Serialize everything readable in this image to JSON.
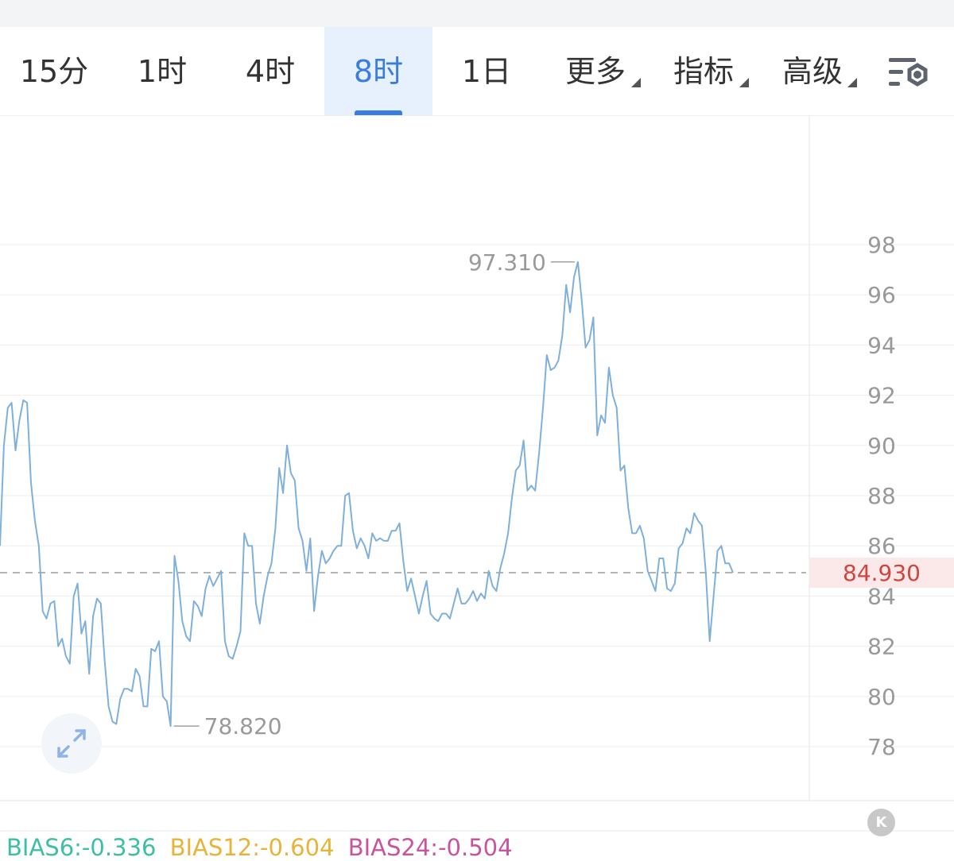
{
  "timeframe_tabs": [
    {
      "label": "15分",
      "active": false
    },
    {
      "label": "1时",
      "active": false
    },
    {
      "label": "4时",
      "active": false
    },
    {
      "label": "8时",
      "active": true
    },
    {
      "label": "1日",
      "active": false
    }
  ],
  "menu_tabs": [
    {
      "label": "更多"
    },
    {
      "label": "指标"
    },
    {
      "label": "高级"
    }
  ],
  "icons": {
    "settings": "chart-settings-icon",
    "expand": "expand-icon",
    "scroll_latest": "scroll-to-latest-icon"
  },
  "scroll_latest_label": "K",
  "colors": {
    "accent": "#3a7ce0",
    "line": "#7fb0dc",
    "current_price": "#d0453f",
    "bias6": "#3dbfa5",
    "bias12": "#e7b439",
    "bias24": "#c9549d"
  },
  "chart_data": {
    "type": "line",
    "y_axis_ticks": [
      "98",
      "96",
      "94",
      "92",
      "90",
      "88",
      "86",
      "84",
      "82",
      "80",
      "78"
    ],
    "ylim": [
      76,
      102
    ],
    "current_price": "84.930",
    "max_label": "97.310",
    "min_label": "78.820",
    "values": [
      86.0,
      90.0,
      91.5,
      91.7,
      89.8,
      91.0,
      91.8,
      91.7,
      88.5,
      87.0,
      86.0,
      83.4,
      83.1,
      83.7,
      83.8,
      82.0,
      82.3,
      81.6,
      81.3,
      84.0,
      84.5,
      82.5,
      83.0,
      80.9,
      83.2,
      83.9,
      83.7,
      81.4,
      79.6,
      79.0,
      78.9,
      79.9,
      80.3,
      80.3,
      80.2,
      81.1,
      80.8,
      79.6,
      79.6,
      81.9,
      81.8,
      82.2,
      80.0,
      79.8,
      78.82,
      85.6,
      84.6,
      83.0,
      82.4,
      82.2,
      83.8,
      83.6,
      83.2,
      84.3,
      84.8,
      84.4,
      84.7,
      85.0,
      82.2,
      81.6,
      81.5,
      82.0,
      82.6,
      86.5,
      86.0,
      86.0,
      83.7,
      82.9,
      84.0,
      84.8,
      85.3,
      86.7,
      89.1,
      88.1,
      90.0,
      88.9,
      88.6,
      86.7,
      86.2,
      85.0,
      86.3,
      83.4,
      84.8,
      85.8,
      85.3,
      85.5,
      85.8,
      86.0,
      86.0,
      88.0,
      88.1,
      86.6,
      85.9,
      86.3,
      86.0,
      85.5,
      86.5,
      86.2,
      86.3,
      86.2,
      86.2,
      86.6,
      86.6,
      86.9,
      85.4,
      84.2,
      84.7,
      84.0,
      83.3,
      84.0,
      84.6,
      83.3,
      83.1,
      83.0,
      83.3,
      83.3,
      83.1,
      83.7,
      84.3,
      83.7,
      83.7,
      83.9,
      84.2,
      83.8,
      84.1,
      83.9,
      85.0,
      84.4,
      84.2,
      85.1,
      85.7,
      86.5,
      87.9,
      89.0,
      89.2,
      90.2,
      88.2,
      88.4,
      88.2,
      89.7,
      91.5,
      93.6,
      93.0,
      93.1,
      93.4,
      94.4,
      96.4,
      95.3,
      96.7,
      97.31,
      95.8,
      93.9,
      94.2,
      95.1,
      90.4,
      91.2,
      90.9,
      93.1,
      92.0,
      91.5,
      89.0,
      89.2,
      87.5,
      86.5,
      86.5,
      86.8,
      86.3,
      85.0,
      84.6,
      84.2,
      85.5,
      85.5,
      84.3,
      84.2,
      84.5,
      85.9,
      86.1,
      86.7,
      86.5,
      87.3,
      87.0,
      86.8,
      84.9,
      82.2,
      84.0,
      85.8,
      86.0,
      85.3,
      85.3,
      84.93
    ]
  },
  "indicators": [
    {
      "label": "BIAS6:-0.336",
      "color_key": "bias6"
    },
    {
      "label": "BIAS12:-0.604",
      "color_key": "bias12"
    },
    {
      "label": "BIAS24:-0.504",
      "color_key": "bias24"
    }
  ]
}
